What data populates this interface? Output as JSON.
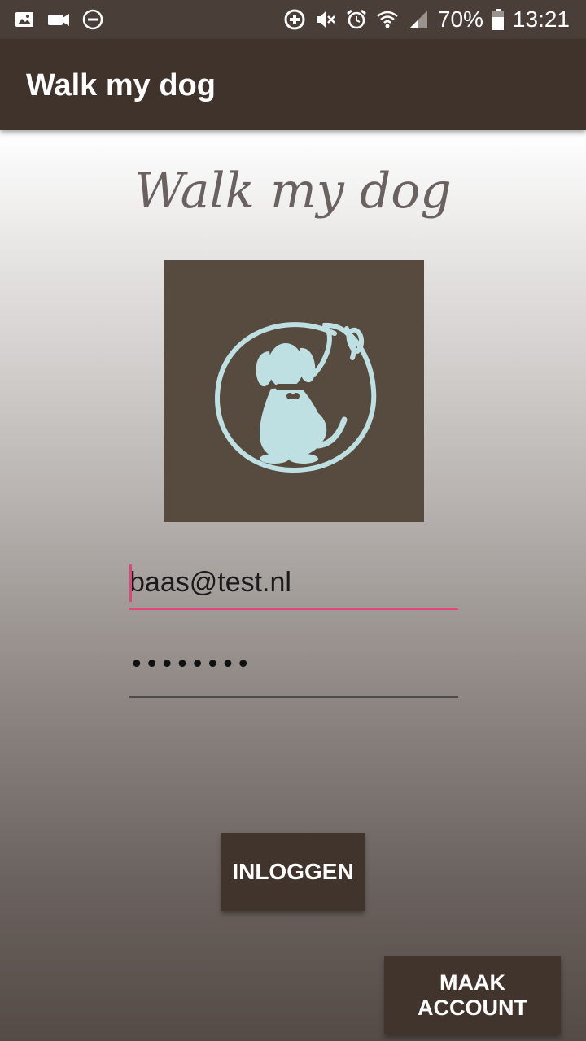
{
  "status_bar": {
    "left_icons": [
      "image-icon",
      "video-camera-icon",
      "do-not-disturb-icon"
    ],
    "right_icons": [
      "data-saver-icon",
      "mute-icon",
      "alarm-icon",
      "wifi-icon",
      "signal-icon",
      "battery-icon"
    ],
    "battery_percent": "70%",
    "time": "13:21"
  },
  "app_bar": {
    "title": "Walk my dog"
  },
  "logo": {
    "script_title": "Walk my dog",
    "image_icon": "dog-with-leash-logo",
    "colors": {
      "box": "#574a3e",
      "dog": "#bfe0e2"
    }
  },
  "login_form": {
    "email": {
      "value": "baas@test.nl",
      "placeholder": ""
    },
    "password": {
      "masked_value": "••••••••"
    }
  },
  "buttons": {
    "login": "INLOGGEN",
    "signup": "MAAK ACCOUNT"
  },
  "colors": {
    "app_bar": "#3f332c",
    "status_bar": "#4a3f38",
    "accent": "#e0457b",
    "button": "#41342c"
  }
}
